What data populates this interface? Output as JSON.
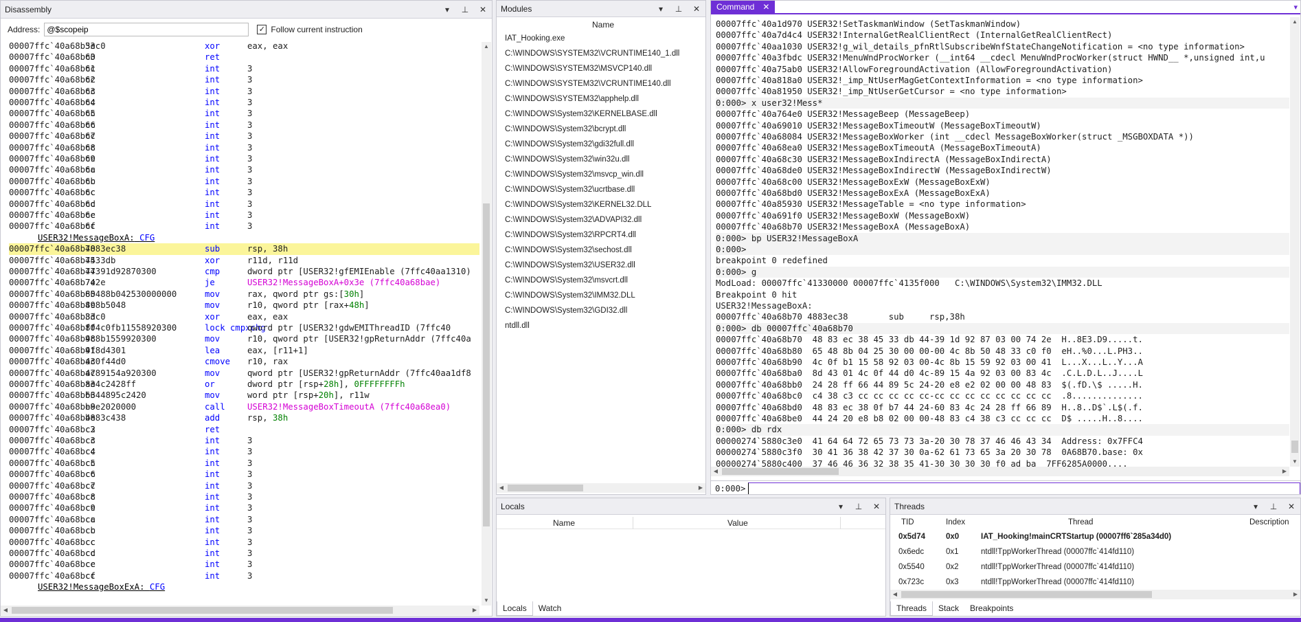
{
  "disassembly": {
    "title": "Disassembly",
    "address_label": "Address:",
    "address_value": "@$scopeip",
    "follow_checked": "✓",
    "follow_label": "Follow current instruction",
    "rows": [
      {
        "a": "00007ffc`40a68b5e",
        "b": "33c0",
        "o": "xor",
        "g": "eax, eax"
      },
      {
        "a": "00007ffc`40a68b60",
        "b": "c3",
        "o": "ret",
        "g": ""
      },
      {
        "a": "00007ffc`40a68b61",
        "b": "cc",
        "o": "int",
        "g": "3"
      },
      {
        "a": "00007ffc`40a68b62",
        "b": "cc",
        "o": "int",
        "g": "3"
      },
      {
        "a": "00007ffc`40a68b63",
        "b": "cc",
        "o": "int",
        "g": "3"
      },
      {
        "a": "00007ffc`40a68b64",
        "b": "cc",
        "o": "int",
        "g": "3"
      },
      {
        "a": "00007ffc`40a68b65",
        "b": "cc",
        "o": "int",
        "g": "3"
      },
      {
        "a": "00007ffc`40a68b66",
        "b": "cc",
        "o": "int",
        "g": "3"
      },
      {
        "a": "00007ffc`40a68b67",
        "b": "cc",
        "o": "int",
        "g": "3"
      },
      {
        "a": "00007ffc`40a68b68",
        "b": "cc",
        "o": "int",
        "g": "3"
      },
      {
        "a": "00007ffc`40a68b69",
        "b": "cc",
        "o": "int",
        "g": "3"
      },
      {
        "a": "00007ffc`40a68b6a",
        "b": "cc",
        "o": "int",
        "g": "3"
      },
      {
        "a": "00007ffc`40a68b6b",
        "b": "cc",
        "o": "int",
        "g": "3"
      },
      {
        "a": "00007ffc`40a68b6c",
        "b": "cc",
        "o": "int",
        "g": "3"
      },
      {
        "a": "00007ffc`40a68b6d",
        "b": "cc",
        "o": "int",
        "g": "3"
      },
      {
        "a": "00007ffc`40a68b6e",
        "b": "cc",
        "o": "int",
        "g": "3"
      },
      {
        "a": "00007ffc`40a68b6f",
        "b": "cc",
        "o": "int",
        "g": "3"
      },
      {
        "label": "USER32!MessageBoxA:",
        "cfg": "CFG"
      },
      {
        "a": "00007ffc`40a68b70",
        "b": "4883ec38",
        "o": "sub",
        "g": "rsp, 38h",
        "hl": true
      },
      {
        "a": "00007ffc`40a68b74",
        "b": "4533db",
        "o": "xor",
        "g": "r11d, r11d"
      },
      {
        "a": "00007ffc`40a68b77",
        "b": "44391d92870300",
        "o": "cmp",
        "g": "dword ptr [USER32!gfEMIEnable (7ffc40aa1310)"
      },
      {
        "a": "00007ffc`40a68b7e",
        "b": "742e",
        "o": "je",
        "g": "",
        "m": "USER32!MessageBoxA+0x3e (7ffc40a68bae)"
      },
      {
        "a": "00007ffc`40a68b80",
        "b": "65488b042530000000",
        "o": "mov",
        "g": "rax, qword ptr gs:[",
        "gr": "30h",
        "g2": "]"
      },
      {
        "a": "00007ffc`40a68b89",
        "b": "4c8b5048",
        "o": "mov",
        "g": "r10, qword ptr [rax+",
        "gr": "48h",
        "g2": "]"
      },
      {
        "a": "00007ffc`40a68b8d",
        "b": "33c0",
        "o": "xor",
        "g": "eax, eax"
      },
      {
        "a": "00007ffc`40a68b8f",
        "b": "f04c0fb11558920300",
        "o": "lock cmpxchg",
        "g": "qword ptr [USER32!gdwEMIThreadID (7ffc40"
      },
      {
        "a": "00007ffc`40a68b98",
        "b": "4c8b1559920300",
        "o": "mov",
        "g": "r10, qword ptr [USER32!gpReturnAddr (7ffc40a"
      },
      {
        "a": "00007ffc`40a68b9f",
        "b": "418d4301",
        "o": "lea",
        "g": "eax, [r11+1]"
      },
      {
        "a": "00007ffc`40a68ba3",
        "b": "4c0f44d0",
        "o": "cmove",
        "g": "r10, rax"
      },
      {
        "a": "00007ffc`40a68ba7",
        "b": "4c89154a920300",
        "o": "mov",
        "g": "qword ptr [USER32!gpReturnAddr (7ffc40aa1df8"
      },
      {
        "a": "00007ffc`40a68bae",
        "b": "834c2428ff",
        "o": "or",
        "g": "dword ptr [rsp+",
        "gr": "28h",
        "g2": "], ",
        "gr2": "0FFFFFFFFh"
      },
      {
        "a": "00007ffc`40a68bb3",
        "b": "6644895c2420",
        "o": "mov",
        "g": "word ptr [rsp+",
        "gr": "20h",
        "g2": "], r11w"
      },
      {
        "a": "00007ffc`40a68bb9",
        "b": "e8e2020000",
        "o": "call",
        "g": "",
        "m": "USER32!MessageBoxTimeoutA (7ffc40a68ea0)"
      },
      {
        "a": "00007ffc`40a68bbe",
        "b": "4883c438",
        "o": "add",
        "g": "rsp, ",
        "gr": "38h"
      },
      {
        "a": "00007ffc`40a68bc2",
        "b": "c3",
        "o": "ret",
        "g": ""
      },
      {
        "a": "00007ffc`40a68bc3",
        "b": "cc",
        "o": "int",
        "g": "3"
      },
      {
        "a": "00007ffc`40a68bc4",
        "b": "cc",
        "o": "int",
        "g": "3"
      },
      {
        "a": "00007ffc`40a68bc5",
        "b": "cc",
        "o": "int",
        "g": "3"
      },
      {
        "a": "00007ffc`40a68bc6",
        "b": "cc",
        "o": "int",
        "g": "3"
      },
      {
        "a": "00007ffc`40a68bc7",
        "b": "cc",
        "o": "int",
        "g": "3"
      },
      {
        "a": "00007ffc`40a68bc8",
        "b": "cc",
        "o": "int",
        "g": "3"
      },
      {
        "a": "00007ffc`40a68bc9",
        "b": "cc",
        "o": "int",
        "g": "3"
      },
      {
        "a": "00007ffc`40a68bca",
        "b": "cc",
        "o": "int",
        "g": "3"
      },
      {
        "a": "00007ffc`40a68bcb",
        "b": "cc",
        "o": "int",
        "g": "3"
      },
      {
        "a": "00007ffc`40a68bcc",
        "b": "cc",
        "o": "int",
        "g": "3"
      },
      {
        "a": "00007ffc`40a68bcd",
        "b": "cc",
        "o": "int",
        "g": "3"
      },
      {
        "a": "00007ffc`40a68bce",
        "b": "cc",
        "o": "int",
        "g": "3"
      },
      {
        "a": "00007ffc`40a68bcf",
        "b": "cc",
        "o": "int",
        "g": "3"
      },
      {
        "label": "USER32!MessageBoxExA:",
        "cfg": "CFG"
      }
    ]
  },
  "modules": {
    "title": "Modules",
    "column": "Name",
    "items": [
      "IAT_Hooking.exe",
      "C:\\WINDOWS\\SYSTEM32\\VCRUNTIME140_1.dll",
      "C:\\WINDOWS\\SYSTEM32\\MSVCP140.dll",
      "C:\\WINDOWS\\SYSTEM32\\VCRUNTIME140.dll",
      "C:\\WINDOWS\\SYSTEM32\\apphelp.dll",
      "C:\\WINDOWS\\System32\\KERNELBASE.dll",
      "C:\\WINDOWS\\System32\\bcrypt.dll",
      "C:\\WINDOWS\\System32\\gdi32full.dll",
      "C:\\WINDOWS\\System32\\win32u.dll",
      "C:\\WINDOWS\\System32\\msvcp_win.dll",
      "C:\\WINDOWS\\System32\\ucrtbase.dll",
      "C:\\WINDOWS\\System32\\KERNEL32.DLL",
      "C:\\WINDOWS\\System32\\ADVAPI32.dll",
      "C:\\WINDOWS\\System32\\RPCRT4.dll",
      "C:\\WINDOWS\\System32\\sechost.dll",
      "C:\\WINDOWS\\System32\\USER32.dll",
      "C:\\WINDOWS\\System32\\msvcrt.dll",
      "C:\\WINDOWS\\System32\\IMM32.DLL",
      "C:\\WINDOWS\\System32\\GDI32.dll",
      "ntdll.dll"
    ]
  },
  "command": {
    "title": "Command",
    "prompt": "0:000>",
    "lines": [
      {
        "t": "00007ffc`40a1d970 USER32!SetTaskmanWindow (SetTaskmanWindow)"
      },
      {
        "t": "00007ffc`40a7d4c4 USER32!InternalGetRealClientRect (InternalGetRealClientRect)"
      },
      {
        "t": "00007ffc`40aa1030 USER32!g_wil_details_pfnRtlSubscribeWnfStateChangeNotification = <no type information>"
      },
      {
        "t": "00007ffc`40a3fbdc USER32!MenuWndProcWorker (__int64 __cdecl MenuWndProcWorker(struct HWND__ *,unsigned int,u"
      },
      {
        "t": "00007ffc`40a75ab0 USER32!AllowForegroundActivation (AllowForegroundActivation)"
      },
      {
        "t": "00007ffc`40a818a0 USER32!_imp_NtUserMagGetContextInformation = <no type information>"
      },
      {
        "t": "00007ffc`40a81950 USER32!_imp_NtUserGetCursor = <no type information>"
      },
      {
        "t": "0:000> x user32!Mess*",
        "in": true
      },
      {
        "t": "00007ffc`40a764e0 USER32!MessageBeep (MessageBeep)"
      },
      {
        "t": "00007ffc`40a69010 USER32!MessageBoxTimeoutW (MessageBoxTimeoutW)"
      },
      {
        "t": "00007ffc`40a68084 USER32!MessageBoxWorker (int __cdecl MessageBoxWorker(struct _MSGBOXDATA *))"
      },
      {
        "t": "00007ffc`40a68ea0 USER32!MessageBoxTimeoutA (MessageBoxTimeoutA)"
      },
      {
        "t": "00007ffc`40a68c30 USER32!MessageBoxIndirectA (MessageBoxIndirectA)"
      },
      {
        "t": "00007ffc`40a68de0 USER32!MessageBoxIndirectW (MessageBoxIndirectW)"
      },
      {
        "t": "00007ffc`40a68c00 USER32!MessageBoxExW (MessageBoxExW)"
      },
      {
        "t": "00007ffc`40a68bd0 USER32!MessageBoxExA (MessageBoxExA)"
      },
      {
        "t": "00007ffc`40a85930 USER32!MessageTable = <no type information>"
      },
      {
        "t": "00007ffc`40a691f0 USER32!MessageBoxW (MessageBoxW)"
      },
      {
        "t": "00007ffc`40a68b70 USER32!MessageBoxA (MessageBoxA)"
      },
      {
        "t": "0:000> bp USER32!MessageBoxA",
        "in": true
      },
      {
        "t": "0:000>",
        "in": true
      },
      {
        "t": "breakpoint 0 redefined"
      },
      {
        "t": "0:000> g",
        "in": true
      },
      {
        "t": "ModLoad: 00007ffc`41330000 00007ffc`4135f000   C:\\WINDOWS\\System32\\IMM32.DLL"
      },
      {
        "t": "Breakpoint 0 hit"
      },
      {
        "t": "USER32!MessageBoxA:"
      },
      {
        "t": "00007ffc`40a68b70 4883ec38        sub     rsp,38h"
      },
      {
        "t": "0:000> db 00007ffc`40a68b70",
        "in": true
      },
      {
        "t": "00007ffc`40a68b70  48 83 ec 38 45 33 db 44-39 1d 92 87 03 00 74 2e  H..8E3.D9.....t."
      },
      {
        "t": "00007ffc`40a68b80  65 48 8b 04 25 30 00 00-00 4c 8b 50 48 33 c0 f0  eH..%0...L.PH3.."
      },
      {
        "t": "00007ffc`40a68b90  4c 0f b1 15 58 92 03 00-4c 8b 15 59 92 03 00 41  L...X...L..Y...A"
      },
      {
        "t": "00007ffc`40a68ba0  8d 43 01 4c 0f 44 d0 4c-89 15 4a 92 03 00 83 4c  .C.L.D.L..J....L"
      },
      {
        "t": "00007ffc`40a68bb0  24 28 ff 66 44 89 5c 24-20 e8 e2 02 00 00 48 83  $(.fD.\\$ .....H."
      },
      {
        "t": "00007ffc`40a68bc0  c4 38 c3 cc cc cc cc cc-cc cc cc cc cc cc cc cc  .8.............."
      },
      {
        "t": "00007ffc`40a68bd0  48 83 ec 38 0f b7 44 24-60 83 4c 24 28 ff 66 89  H..8..D$`.L$(.f."
      },
      {
        "t": "00007ffc`40a68be0  44 24 20 e8 b8 02 00 00-48 83 c4 38 c3 cc cc cc  D$ .....H..8...."
      },
      {
        "t": "0:000> db rdx",
        "in": true
      },
      {
        "t": "00000274`5880c3e0  41 64 64 72 65 73 73 3a-20 30 78 37 46 46 43 34  Address: 0x7FFC4"
      },
      {
        "t": "00000274`5880c3f0  30 41 36 38 42 37 30 0a-62 61 73 65 3a 20 30 78  0A68B70.base: 0x"
      },
      {
        "t": "00000274`5880c400  37 46 46 36 32 38 35 41-30 30 30 30 f0 ad ba  7FF6285A0000...."
      }
    ]
  },
  "locals": {
    "title": "Locals",
    "col_name": "Name",
    "col_value": "Value",
    "tab_locals": "Locals",
    "tab_watch": "Watch"
  },
  "threads": {
    "title": "Threads",
    "cols": {
      "tid": "TID",
      "index": "Index",
      "thread": "Thread",
      "desc": "Description"
    },
    "rows": [
      {
        "tid": "0x5d74",
        "index": "0x0",
        "thread": "IAT_Hooking!mainCRTStartup (00007ff6`285a34d0)",
        "bold": true
      },
      {
        "tid": "0x6edc",
        "index": "0x1",
        "thread": "ntdll!TppWorkerThread (00007ffc`414fd110)"
      },
      {
        "tid": "0x5540",
        "index": "0x2",
        "thread": "ntdll!TppWorkerThread (00007ffc`414fd110)"
      },
      {
        "tid": "0x723c",
        "index": "0x3",
        "thread": "ntdll!TppWorkerThread (00007ffc`414fd110)"
      }
    ],
    "tab_threads": "Threads",
    "tab_stack": "Stack",
    "tab_breakpoints": "Breakpoints"
  },
  "colors": {
    "accent": "#6e2fd6",
    "highlight": "#fbf59a",
    "keyword": "#0000ff",
    "symbol": "#d400d4",
    "number": "#008000"
  }
}
